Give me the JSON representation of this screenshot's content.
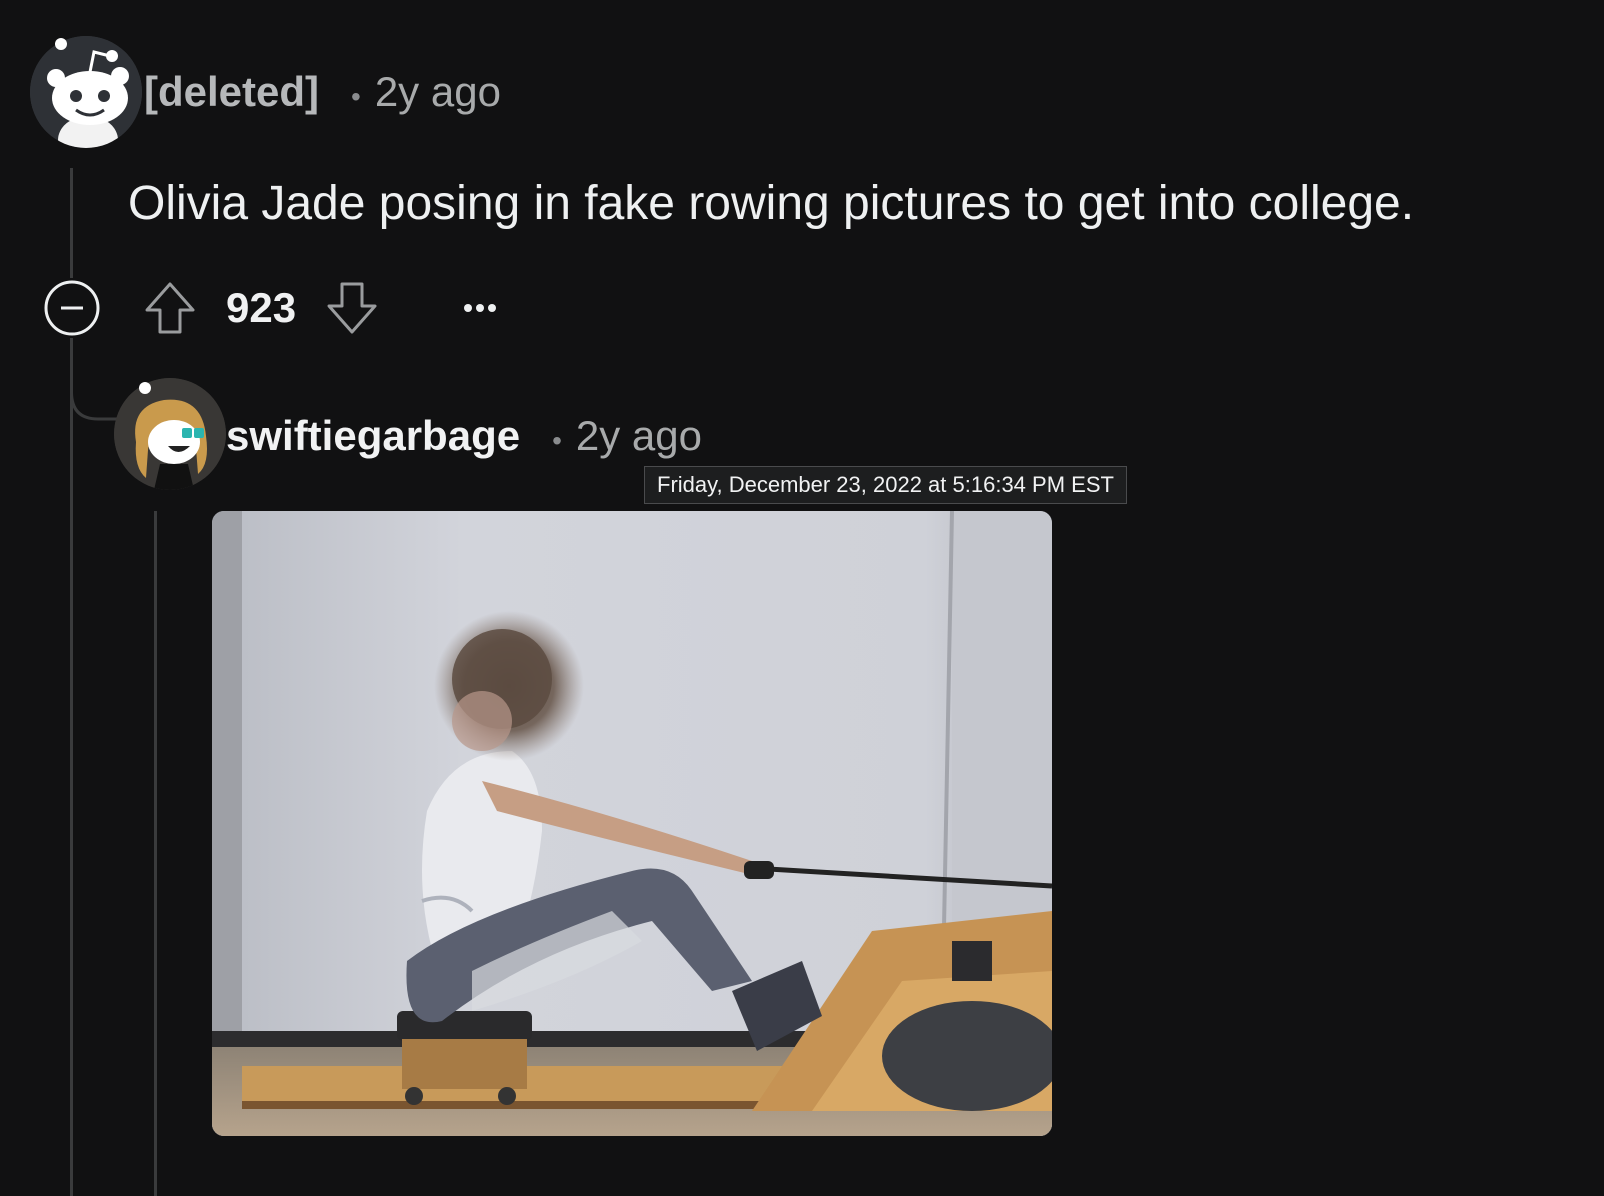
{
  "comment": {
    "author": "[deleted]",
    "separator": "•",
    "time": "2y ago",
    "body": "Olivia Jade posing in fake rowing pictures to get into college.",
    "score": "923",
    "collapse_icon": "minus-circle-icon",
    "upvote_icon": "arrow-up-icon",
    "downvote_icon": "arrow-down-icon",
    "more_icon": "ellipsis-icon"
  },
  "reply": {
    "author": "swiftiegarbage",
    "separator": "•",
    "time": "2y ago",
    "timestamp_tooltip": "Friday, December 23, 2022 at 5:16:34 PM EST",
    "image_subject": "person on rowing machine"
  },
  "colors": {
    "background": "#111112",
    "thread_line": "#3a3b3c",
    "text_primary": "#eef0f1",
    "text_muted": "#a8aaab"
  }
}
